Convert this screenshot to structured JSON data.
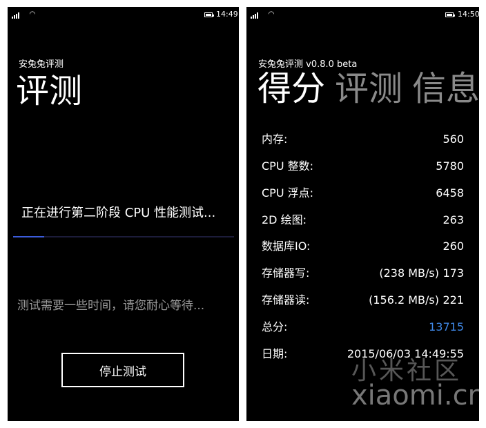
{
  "left_screen": {
    "status": {
      "time": "14:49"
    },
    "app_title": "安兔兔评测",
    "page_title": "评测",
    "progress_text": "正在进行第二阶段 CPU 性能测试...",
    "progress_fraction": 0.14,
    "hint_text": "测试需要一些时间，请您耐心等待...",
    "stop_button": "停止测试"
  },
  "right_screen": {
    "status": {
      "time": "14:50"
    },
    "app_title": "安兔兔评测 v0.8.0 beta",
    "pivot": {
      "active": "得分",
      "items": [
        "评测",
        "信息"
      ]
    },
    "rows": [
      {
        "label": "内存:",
        "value": "560"
      },
      {
        "label": "CPU 整数:",
        "value": "5780"
      },
      {
        "label": "CPU 浮点:",
        "value": "6458"
      },
      {
        "label": "2D 绘图:",
        "value": "263"
      },
      {
        "label": "数据库IO:",
        "value": "260"
      },
      {
        "label": "存储器写:",
        "extra": "(238 MB/s)",
        "value": "173"
      },
      {
        "label": "存储器读:",
        "extra": "(156.2 MB/s)",
        "value": "221"
      },
      {
        "label": "总分:",
        "value": "13715"
      },
      {
        "label": "日期:",
        "value": "2015/06/03 14:49:55"
      }
    ],
    "accent_color": "#3f88e6",
    "watermark": {
      "cn": "小米社区",
      "en": "xiaomi.cn"
    }
  }
}
